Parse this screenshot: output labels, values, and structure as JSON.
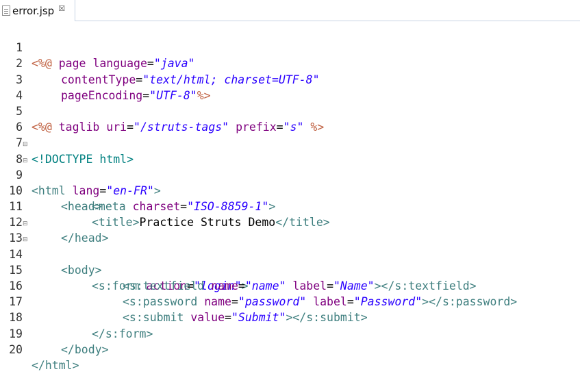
{
  "editor_tab": {
    "filename": "error.jsp",
    "close_glyph": "☒"
  },
  "colors": {
    "tag": "#3f7f7f",
    "attribute_name": "#7f007f",
    "attribute_value": "#2a00ff",
    "jsp_directive": "#bf5f3f",
    "doctype": "#008080",
    "text": "#000000"
  },
  "icons": {
    "tab_file": "file-icon",
    "fold": "fold-minus-icon"
  },
  "lines": [
    {
      "num": "1",
      "fold": "",
      "tokens": [
        {
          "k": "dir",
          "t": "<%@"
        },
        {
          "k": "plain",
          "t": " "
        },
        {
          "k": "attr",
          "t": "page"
        },
        {
          "k": "plain",
          "t": " "
        },
        {
          "k": "attr",
          "t": "language"
        },
        {
          "k": "plain",
          "t": "="
        },
        {
          "k": "val",
          "t": "\"java\""
        }
      ]
    },
    {
      "num": "2",
      "fold": "",
      "tokens": [
        {
          "k": "attr",
          "t": "contentType"
        },
        {
          "k": "plain",
          "t": "="
        },
        {
          "k": "val",
          "t": "\"text/html; charset=UTF-8\""
        }
      ]
    },
    {
      "num": "3",
      "fold": "",
      "tokens": [
        {
          "k": "attr",
          "t": "pageEncoding"
        },
        {
          "k": "plain",
          "t": "="
        },
        {
          "k": "val",
          "t": "\"UTF-8\""
        },
        {
          "k": "dir",
          "t": "%>"
        }
      ]
    },
    {
      "num": "4",
      "fold": "",
      "tokens": []
    },
    {
      "num": "5",
      "fold": "",
      "tokens": [
        {
          "k": "dir",
          "t": "<%@"
        },
        {
          "k": "plain",
          "t": " "
        },
        {
          "k": "attr",
          "t": "taglib"
        },
        {
          "k": "plain",
          "t": " "
        },
        {
          "k": "attr",
          "t": "uri"
        },
        {
          "k": "plain",
          "t": "="
        },
        {
          "k": "val",
          "t": "\"/struts-tags\""
        },
        {
          "k": "plain",
          "t": " "
        },
        {
          "k": "attr",
          "t": "prefix"
        },
        {
          "k": "plain",
          "t": "="
        },
        {
          "k": "val",
          "t": "\"s\""
        },
        {
          "k": "plain",
          "t": " "
        },
        {
          "k": "dir",
          "t": "%>"
        }
      ]
    },
    {
      "num": "6",
      "fold": "",
      "tokens": []
    },
    {
      "num": "7",
      "fold": "",
      "tokens": [
        {
          "k": "doc",
          "t": "<!DOCTYPE html>"
        }
      ]
    },
    {
      "num": "8",
      "fold": "⊟",
      "tokens": [
        {
          "k": "tag",
          "t": "<html"
        },
        {
          "k": "plain",
          "t": " "
        },
        {
          "k": "attr",
          "t": "lang"
        },
        {
          "k": "plain",
          "t": "="
        },
        {
          "k": "val",
          "t": "\"en-FR\""
        },
        {
          "k": "tag",
          "t": ">"
        }
      ]
    },
    {
      "num": "9",
      "fold": "⊟",
      "tokens": [
        {
          "k": "tag",
          "t": "<head>"
        }
      ]
    },
    {
      "num": "10",
      "fold": "",
      "tokens": [
        {
          "k": "tag",
          "t": "<meta"
        },
        {
          "k": "plain",
          "t": " "
        },
        {
          "k": "attr",
          "t": "charset"
        },
        {
          "k": "plain",
          "t": "="
        },
        {
          "k": "val",
          "t": "\"ISO-8859-1\""
        },
        {
          "k": "tag",
          "t": ">"
        }
      ]
    },
    {
      "num": "11",
      "fold": "",
      "tokens": [
        {
          "k": "tag",
          "t": "<title>"
        },
        {
          "k": "plain",
          "t": "Practice Struts Demo"
        },
        {
          "k": "tag",
          "t": "</title>"
        }
      ]
    },
    {
      "num": "12",
      "fold": "",
      "tokens": [
        {
          "k": "tag",
          "t": "</head>"
        }
      ]
    },
    {
      "num": "13",
      "fold": "⊟",
      "tokens": [
        {
          "k": "tag",
          "t": "<body>"
        }
      ]
    },
    {
      "num": "14",
      "fold": "⊟",
      "tokens": [
        {
          "k": "tag",
          "t": "<s:form"
        },
        {
          "k": "plain",
          "t": " "
        },
        {
          "k": "attr",
          "t": "action"
        },
        {
          "k": "plain",
          "t": "="
        },
        {
          "k": "val",
          "t": "\"login\""
        },
        {
          "k": "tag",
          "t": ">"
        }
      ]
    },
    {
      "num": "15",
      "fold": "",
      "tokens": [
        {
          "k": "tag",
          "t": "<s:textfield"
        },
        {
          "k": "plain",
          "t": " "
        },
        {
          "k": "attr",
          "t": "name"
        },
        {
          "k": "plain",
          "t": "="
        },
        {
          "k": "val",
          "t": "\"name\""
        },
        {
          "k": "plain",
          "t": " "
        },
        {
          "k": "attr",
          "t": "label"
        },
        {
          "k": "plain",
          "t": "="
        },
        {
          "k": "val",
          "t": "\"Name\""
        },
        {
          "k": "tag",
          "t": "></s:textfield>"
        }
      ]
    },
    {
      "num": "16",
      "fold": "",
      "tokens": [
        {
          "k": "tag",
          "t": "<s:password"
        },
        {
          "k": "plain",
          "t": " "
        },
        {
          "k": "attr",
          "t": "name"
        },
        {
          "k": "plain",
          "t": "="
        },
        {
          "k": "val",
          "t": "\"password\""
        },
        {
          "k": "plain",
          "t": " "
        },
        {
          "k": "attr",
          "t": "label"
        },
        {
          "k": "plain",
          "t": "="
        },
        {
          "k": "val",
          "t": "\"Password\""
        },
        {
          "k": "tag",
          "t": "></s:password>"
        }
      ]
    },
    {
      "num": "17",
      "fold": "",
      "tokens": [
        {
          "k": "tag",
          "t": "<s:submit"
        },
        {
          "k": "plain",
          "t": " "
        },
        {
          "k": "attr",
          "t": "value"
        },
        {
          "k": "plain",
          "t": "="
        },
        {
          "k": "val",
          "t": "\"Submit\""
        },
        {
          "k": "tag",
          "t": "></s:submit>"
        }
      ]
    },
    {
      "num": "18",
      "fold": "",
      "tokens": [
        {
          "k": "tag",
          "t": "</s:form>"
        }
      ]
    },
    {
      "num": "19",
      "fold": "",
      "tokens": [
        {
          "k": "tag",
          "t": "</body>"
        }
      ]
    },
    {
      "num": "20",
      "fold": "",
      "tokens": [
        {
          "k": "tag",
          "t": "</html>"
        }
      ]
    }
  ]
}
